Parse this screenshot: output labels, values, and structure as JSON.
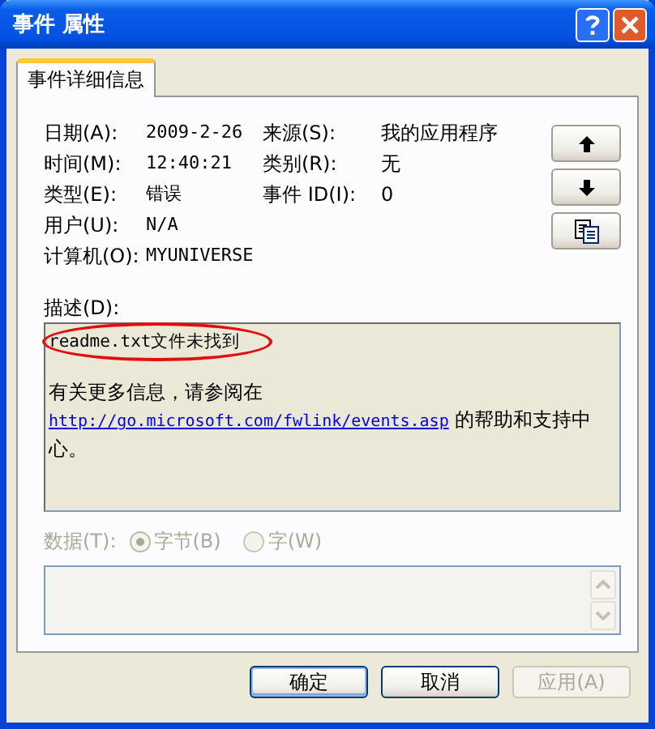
{
  "window": {
    "title": "事件 属性"
  },
  "tabs": [
    {
      "label": "事件详细信息",
      "selected": true
    }
  ],
  "details": [
    [
      {
        "label": "日期(A):",
        "value": "2009-2-26"
      },
      {
        "label": "来源(S):",
        "value": "我的应用程序"
      }
    ],
    [
      {
        "label": "时间(M):",
        "value": "12:40:21"
      },
      {
        "label": "类别(R):",
        "value": "无"
      }
    ],
    [
      {
        "label": "类型(E):",
        "value": "错误"
      },
      {
        "label": "事件 ID(I):",
        "value": "0"
      }
    ],
    [
      {
        "label": "用户(U):",
        "value": "N/A"
      }
    ],
    [
      {
        "label": "计算机(O):",
        "value": "MYUNIVERSE"
      }
    ]
  ],
  "nav_buttons": [
    {
      "kind": "up"
    },
    {
      "kind": "down"
    },
    {
      "kind": "copy"
    }
  ],
  "description": {
    "label": "描述(D):",
    "first_line": "readme.txt文件未找到",
    "circled": true,
    "text_before": "有关更多信息，请参阅在",
    "link": "http://go.microsoft.com/fwlink/events.asp",
    "text_after": "的帮助和支持中心。"
  },
  "data": {
    "label": "数据(T):",
    "disabled": true,
    "options": [
      {
        "label": "字节(B)",
        "selected": true
      },
      {
        "label": "字(W)",
        "selected": false
      }
    ]
  },
  "buttons": [
    {
      "label": "确定",
      "default": true,
      "disabled": false
    },
    {
      "label": "取消",
      "default": false,
      "disabled": false
    },
    {
      "label": "应用(A)",
      "default": false,
      "disabled": true
    }
  ]
}
